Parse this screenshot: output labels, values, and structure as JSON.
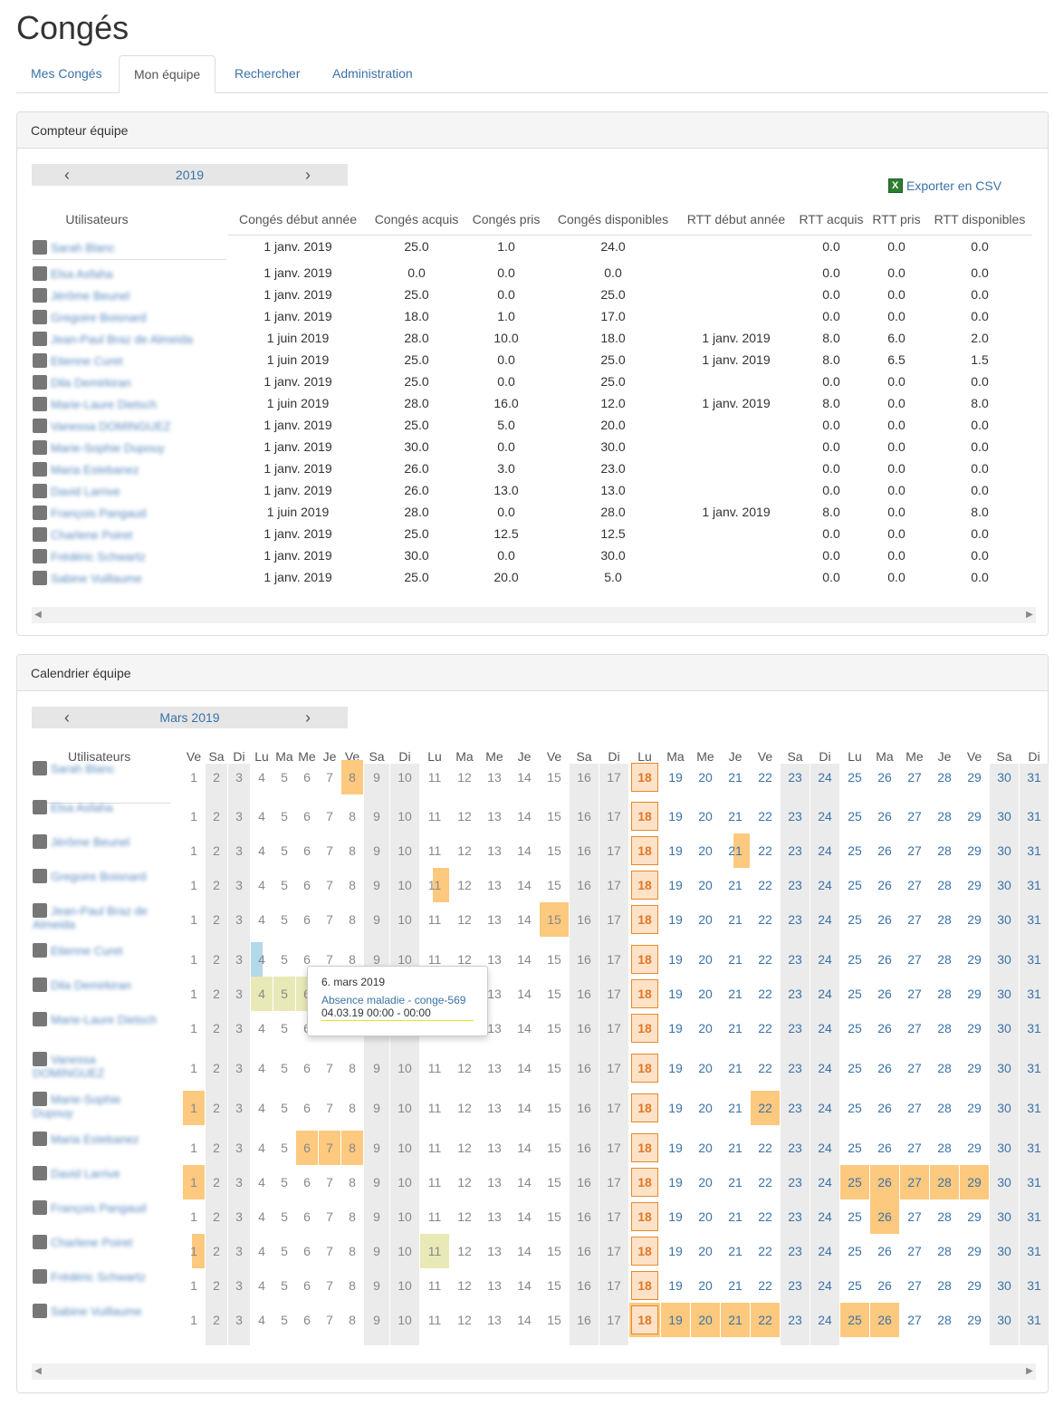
{
  "page_title": "Congés",
  "tabs": [
    "Mes Congés",
    "Mon équipe",
    "Rechercher",
    "Administration"
  ],
  "counter": {
    "panel_title": "Compteur équipe",
    "year": "2019",
    "export_label": "Exporter en CSV",
    "columns": [
      "Utilisateurs",
      "Congés début année",
      "Congés acquis",
      "Congés pris",
      "Congés disponibles",
      "RTT début année",
      "RTT acquis",
      "RTT pris",
      "RTT disponibles"
    ],
    "rows": [
      {
        "user": "Sarah Blanc",
        "start": "1 janv. 2019",
        "acq": "25.0",
        "pris": "1.0",
        "dispo": "24.0",
        "rtt_start": "",
        "rtt_acq": "0.0",
        "rtt_pris": "0.0",
        "rtt_dispo": "0.0"
      },
      {
        "user": "Elsa Asfaha",
        "start": "1 janv. 2019",
        "acq": "0.0",
        "pris": "0.0",
        "dispo": "0.0",
        "rtt_start": "",
        "rtt_acq": "0.0",
        "rtt_pris": "0.0",
        "rtt_dispo": "0.0"
      },
      {
        "user": "Jérôme Beunel",
        "start": "1 janv. 2019",
        "acq": "25.0",
        "pris": "0.0",
        "dispo": "25.0",
        "rtt_start": "",
        "rtt_acq": "0.0",
        "rtt_pris": "0.0",
        "rtt_dispo": "0.0"
      },
      {
        "user": "Gregoire Boisnard",
        "start": "1 janv. 2019",
        "acq": "18.0",
        "pris": "1.0",
        "dispo": "17.0",
        "rtt_start": "",
        "rtt_acq": "0.0",
        "rtt_pris": "0.0",
        "rtt_dispo": "0.0"
      },
      {
        "user": "Jean-Paul Braz de Almeida",
        "start": "1 juin 2019",
        "acq": "28.0",
        "pris": "10.0",
        "dispo": "18.0",
        "rtt_start": "1 janv. 2019",
        "rtt_acq": "8.0",
        "rtt_pris": "6.0",
        "rtt_dispo": "2.0"
      },
      {
        "user": "Etienne Curet",
        "start": "1 juin 2019",
        "acq": "25.0",
        "pris": "0.0",
        "dispo": "25.0",
        "rtt_start": "1 janv. 2019",
        "rtt_acq": "8.0",
        "rtt_pris": "6.5",
        "rtt_dispo": "1.5"
      },
      {
        "user": "Dila Demirkiran",
        "start": "1 janv. 2019",
        "acq": "25.0",
        "pris": "0.0",
        "dispo": "25.0",
        "rtt_start": "",
        "rtt_acq": "0.0",
        "rtt_pris": "0.0",
        "rtt_dispo": "0.0"
      },
      {
        "user": "Marie-Laure Dietsch",
        "start": "1 juin 2019",
        "acq": "28.0",
        "pris": "16.0",
        "dispo": "12.0",
        "rtt_start": "1 janv. 2019",
        "rtt_acq": "8.0",
        "rtt_pris": "0.0",
        "rtt_dispo": "8.0"
      },
      {
        "user": "Vanessa DOMINGUEZ",
        "start": "1 janv. 2019",
        "acq": "25.0",
        "pris": "5.0",
        "dispo": "20.0",
        "rtt_start": "",
        "rtt_acq": "0.0",
        "rtt_pris": "0.0",
        "rtt_dispo": "0.0"
      },
      {
        "user": "Marie-Sophie Dupouy",
        "start": "1 janv. 2019",
        "acq": "30.0",
        "pris": "0.0",
        "dispo": "30.0",
        "rtt_start": "",
        "rtt_acq": "0.0",
        "rtt_pris": "0.0",
        "rtt_dispo": "0.0"
      },
      {
        "user": "Maria Estebanez",
        "start": "1 janv. 2019",
        "acq": "26.0",
        "pris": "3.0",
        "dispo": "23.0",
        "rtt_start": "",
        "rtt_acq": "0.0",
        "rtt_pris": "0.0",
        "rtt_dispo": "0.0"
      },
      {
        "user": "David Larrive",
        "start": "1 janv. 2019",
        "acq": "26.0",
        "pris": "13.0",
        "dispo": "13.0",
        "rtt_start": "",
        "rtt_acq": "0.0",
        "rtt_pris": "0.0",
        "rtt_dispo": "0.0"
      },
      {
        "user": "François Pangaud",
        "start": "1 juin 2019",
        "acq": "28.0",
        "pris": "0.0",
        "dispo": "28.0",
        "rtt_start": "1 janv. 2019",
        "rtt_acq": "8.0",
        "rtt_pris": "0.0",
        "rtt_dispo": "8.0"
      },
      {
        "user": "Charlene Poiret",
        "start": "1 janv. 2019",
        "acq": "25.0",
        "pris": "12.5",
        "dispo": "12.5",
        "rtt_start": "",
        "rtt_acq": "0.0",
        "rtt_pris": "0.0",
        "rtt_dispo": "0.0"
      },
      {
        "user": "Frédéric Schwartz",
        "start": "1 janv. 2019",
        "acq": "30.0",
        "pris": "0.0",
        "dispo": "30.0",
        "rtt_start": "",
        "rtt_acq": "0.0",
        "rtt_pris": "0.0",
        "rtt_dispo": "0.0"
      },
      {
        "user": "Sabine Vuillaume",
        "start": "1 janv. 2019",
        "acq": "25.0",
        "pris": "20.0",
        "dispo": "5.0",
        "rtt_start": "",
        "rtt_acq": "0.0",
        "rtt_pris": "0.0",
        "rtt_dispo": "0.0"
      }
    ]
  },
  "calendar": {
    "panel_title": "Calendrier équipe",
    "month": "Mars 2019",
    "users_header": "Utilisateurs",
    "weekdays": [
      "Ve",
      "Sa",
      "Di",
      "Lu",
      "Ma",
      "Me",
      "Je",
      "Ve",
      "Sa",
      "Di",
      "Lu",
      "Ma",
      "Me",
      "Je",
      "Ve",
      "Sa",
      "Di",
      "Lu",
      "Ma",
      "Me",
      "Je",
      "Ve",
      "Sa",
      "Di",
      "Lu",
      "Ma",
      "Me",
      "Je",
      "Ve",
      "Sa",
      "Di"
    ],
    "today": 18,
    "users": [
      "Sarah Blanc",
      "Elsa Asfaha",
      "Jérôme Beunel",
      "Gregoire Boisnard",
      "Jean-Paul Braz de Almeida",
      "Etienne Curet",
      "Dila Demirkiran",
      "Marie-Laure Dietsch",
      "Vanessa DOMINGUEZ",
      "Marie-Sophie Dupouy",
      "Maria Estebanez",
      "David Larrive",
      "François Pangaud",
      "Charlene Poiret",
      "Frédéric Schwartz",
      "Sabine Vuillaume"
    ],
    "absences": [
      {
        "row": 0,
        "days": [
          8
        ],
        "type": "conge"
      },
      {
        "row": 2,
        "days": [
          21
        ],
        "type": "conge-half"
      },
      {
        "row": 3,
        "days": [
          11
        ],
        "type": "conge-half"
      },
      {
        "row": 4,
        "days": [
          15
        ],
        "type": "conge"
      },
      {
        "row": 5,
        "days": [
          4
        ],
        "type": "maladie-half"
      },
      {
        "row": 6,
        "days": [
          4,
          5,
          6,
          7
        ],
        "type": "maladie"
      },
      {
        "row": 9,
        "days": [
          1,
          22
        ],
        "type": "conge"
      },
      {
        "row": 10,
        "days": [
          6,
          7,
          8
        ],
        "type": "conge"
      },
      {
        "row": 11,
        "days": [
          1,
          25,
          26,
          27,
          28,
          29
        ],
        "type": "conge"
      },
      {
        "row": 12,
        "days": [
          26
        ],
        "type": "conge"
      },
      {
        "row": 13,
        "days": [
          1
        ],
        "type": "conge-half"
      },
      {
        "row": 13,
        "days": [
          11
        ],
        "type": "maladie"
      },
      {
        "row": 15,
        "days": [
          18,
          19,
          20,
          21,
          22,
          25,
          26
        ],
        "type": "conge"
      }
    ],
    "tooltip": {
      "date": "6. mars 2019",
      "label": "Absence maladie - conge-569",
      "time": "04.03.19 00:00 - 00:00"
    }
  }
}
